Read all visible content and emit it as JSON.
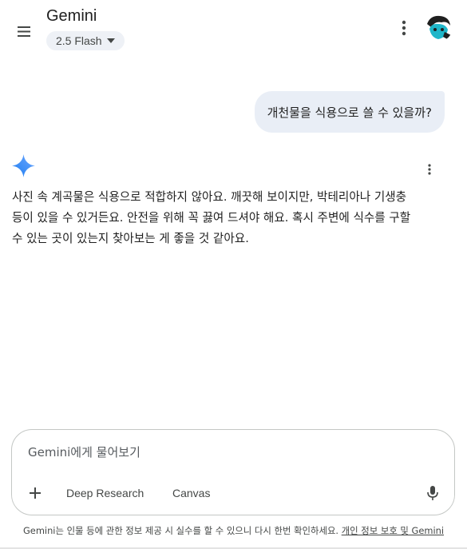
{
  "header": {
    "title": "Gemini",
    "model_label": "2.5 Flash"
  },
  "conversation": {
    "user_message": "개천물을 식용으로 쓸 수 있을까?",
    "response_lines": [
      "사진 속 계곡물은 식용으로 적합하지 않아요. 깨끗해 보이지만, 박테리아나 기생충",
      "등이 있을 수 있거든요. 안전을 위해 꼭 끓여 드셔야 해요. 혹시 주변에 식수를 구할",
      "수 있는 곳이 있는지 찾아보는 게 좋을 것 같아요."
    ]
  },
  "composer": {
    "placeholder": "Gemini에게 물어보기",
    "deep_research_label": "Deep Research",
    "canvas_label": "Canvas"
  },
  "footer": {
    "disclaimer": "Gemini는 인물 등에 관한 정보 제공 시 실수를 할 수 있으니 다시 한번 확인하세요.",
    "privacy_link": "개인 정보 보호 및 Gemini"
  },
  "colors": {
    "accent_blue": "#4285f4",
    "user_bubble": "#e9eef6",
    "pill_bg": "#eef1f6",
    "avatar_teal": "#1fb6c9"
  },
  "icons": [
    "menu-icon",
    "chevron-down-icon",
    "more-vert-icon",
    "avatar",
    "gemini-sparkle-icon",
    "plus-icon",
    "mic-icon"
  ]
}
